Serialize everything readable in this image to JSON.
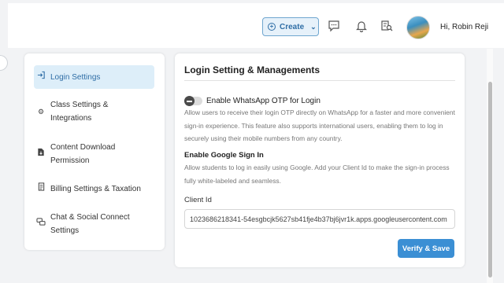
{
  "header": {
    "create_label": "Create",
    "greeting": "Hi, Robin Reji",
    "icons": [
      "chat-icon",
      "bell-icon",
      "search-document-icon",
      "avatar"
    ]
  },
  "sidebar": {
    "items": [
      {
        "label": "Login Settings",
        "icon": "login-icon",
        "active": true
      },
      {
        "label": "Class Settings & Integrations",
        "icon": "gear-icon",
        "active": false
      },
      {
        "label": "Content Download Permission",
        "icon": "download-file-icon",
        "active": false
      },
      {
        "label": "Billing Settings & Taxation",
        "icon": "billing-icon",
        "active": false
      },
      {
        "label": "Chat & Social Connect Settings",
        "icon": "chat-icon",
        "active": false
      }
    ]
  },
  "main": {
    "title": "Login Setting & Managements",
    "whatsapp": {
      "label": "Enable WhatsApp OTP for Login",
      "enabled": false,
      "description": "Allow users to receive their login OTP directly on WhatsApp for a faster and more convenient sign-in experience. This feature also supports international users, enabling them to log in securely using their mobile numbers from any country."
    },
    "google": {
      "title": "Enable Google Sign In",
      "description": "Allow students to log in easily using Google. Add your Client Id to make the sign-in process fully white-labeled and seamless."
    },
    "client_id": {
      "label": "Client Id",
      "value": "1023686218341-54esgbcjk5627sb41fje4b37bj6jvr1k.apps.googleusercontent.com"
    },
    "verify_label": "Verify & Save"
  },
  "colors": {
    "accent": "#3b8fd4",
    "active_bg": "#ddeef9",
    "page_bg": "#f2f3f5"
  }
}
